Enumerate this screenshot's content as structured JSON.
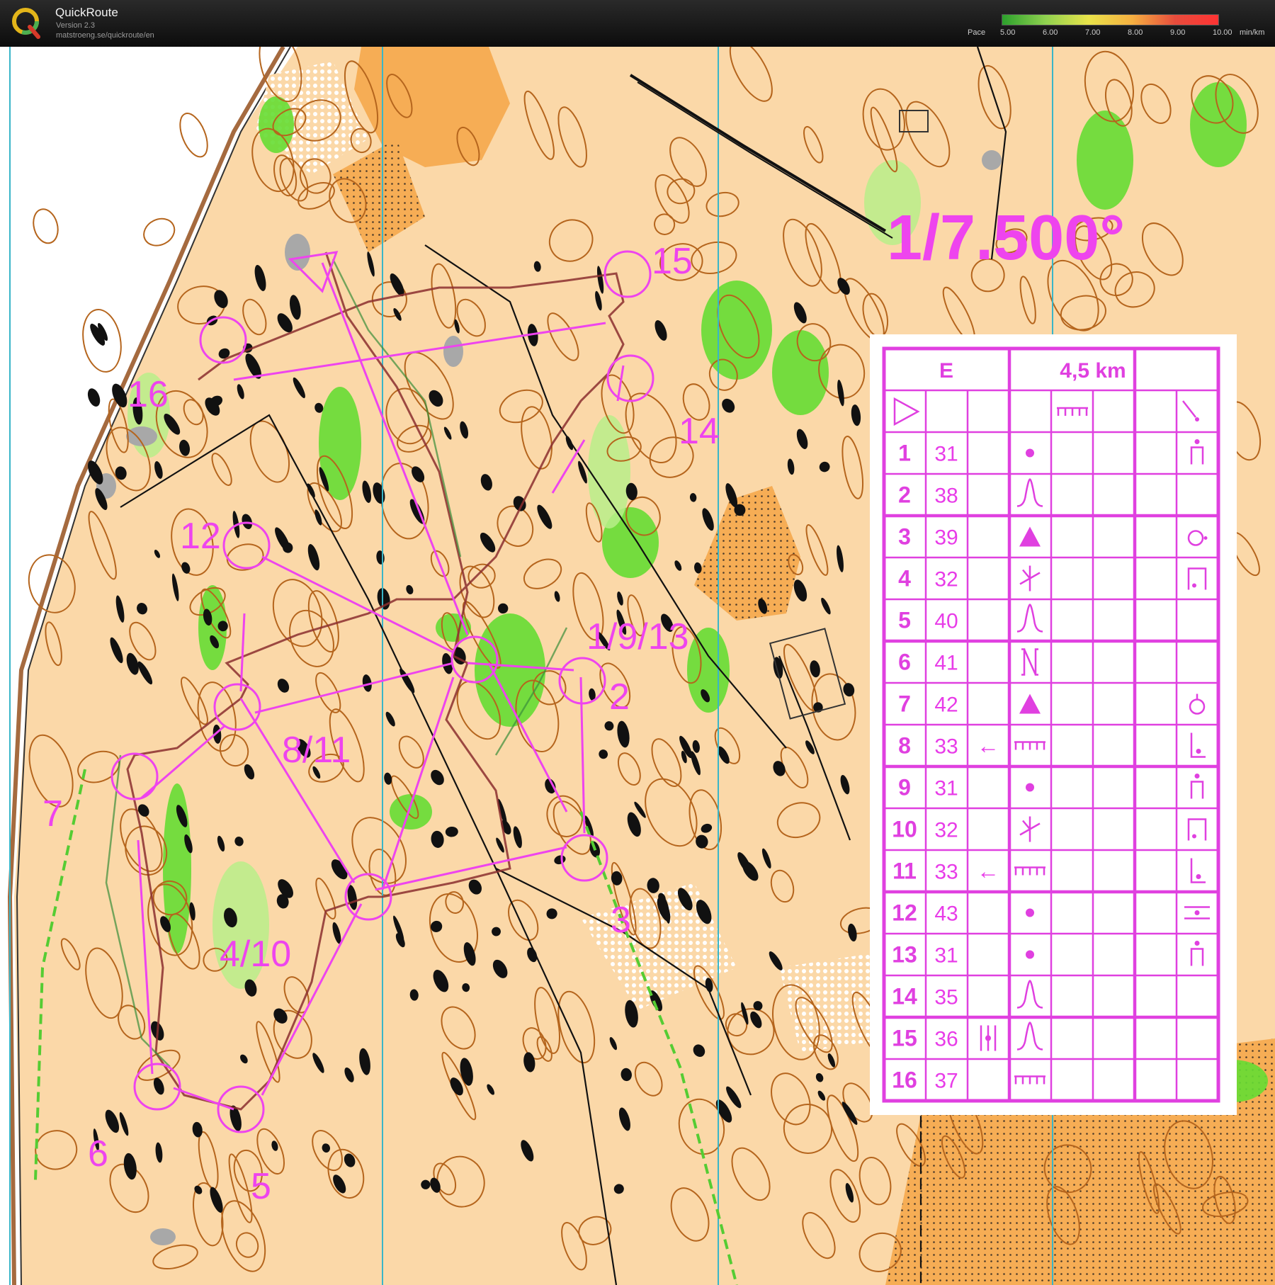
{
  "app": {
    "name": "QuickRoute",
    "version": "Version 2.3",
    "url": "matstroeng.se/quickroute/en"
  },
  "pace_legend": {
    "label": "Pace",
    "ticks": [
      "5.00",
      "6.00",
      "7.00",
      "8.00",
      "9.00",
      "10.00"
    ],
    "unit": "min/km",
    "colors": [
      "#2ca02c",
      "#8fd14f",
      "#e9e34a",
      "#f5b041",
      "#e74c3c"
    ]
  },
  "map": {
    "scale_label": "1/7.500°",
    "colors": {
      "open_land": "#fbd8a8",
      "rough_open": "#f7b25a",
      "vegetation": "#66dd33",
      "contour": "#b5651d",
      "course": "#ee44ee",
      "route": "#8b2f2f",
      "water_grid": "#39b5c8"
    },
    "controls": [
      {
        "label": "1/9/13"
      },
      {
        "label": "2"
      },
      {
        "label": "3"
      },
      {
        "label": "4/10"
      },
      {
        "label": "5"
      },
      {
        "label": "6"
      },
      {
        "label": "7"
      },
      {
        "label": "8/11"
      },
      {
        "label": "12"
      },
      {
        "label": "14"
      },
      {
        "label": "15"
      },
      {
        "label": "16"
      }
    ]
  },
  "control_card": {
    "class": "E",
    "length": "4,5 km",
    "rows": [
      {
        "num": "1",
        "code": "31",
        "dir": "",
        "feature": "dot",
        "detail": "dot-pole"
      },
      {
        "num": "2",
        "code": "38",
        "dir": "",
        "feature": "knoll",
        "detail": ""
      },
      {
        "num": "3",
        "code": "39",
        "dir": "",
        "feature": "triangle",
        "detail": "circle-dot"
      },
      {
        "num": "4",
        "code": "32",
        "dir": "",
        "feature": "cliff-fork",
        "detail": "box-dot"
      },
      {
        "num": "5",
        "code": "40",
        "dir": "",
        "feature": "knoll",
        "detail": ""
      },
      {
        "num": "6",
        "code": "41",
        "dir": "",
        "feature": "bracket",
        "detail": ""
      },
      {
        "num": "7",
        "code": "42",
        "dir": "",
        "feature": "triangle",
        "detail": "circle-top"
      },
      {
        "num": "8",
        "code": "33",
        "dir": "←",
        "feature": "comb",
        "detail": "corner-dot"
      },
      {
        "num": "9",
        "code": "31",
        "dir": "",
        "feature": "dot",
        "detail": "dot-pole"
      },
      {
        "num": "10",
        "code": "32",
        "dir": "",
        "feature": "cliff-fork",
        "detail": "box-dot"
      },
      {
        "num": "11",
        "code": "33",
        "dir": "←",
        "feature": "comb",
        "detail": "corner-dot"
      },
      {
        "num": "12",
        "code": "43",
        "dir": "",
        "feature": "dot",
        "detail": "between"
      },
      {
        "num": "13",
        "code": "31",
        "dir": "",
        "feature": "dot",
        "detail": "dot-pole"
      },
      {
        "num": "14",
        "code": "35",
        "dir": "",
        "feature": "knoll",
        "detail": ""
      },
      {
        "num": "15",
        "code": "36",
        "dir": "bars",
        "feature": "knoll",
        "detail": ""
      },
      {
        "num": "16",
        "code": "37",
        "dir": "",
        "feature": "comb",
        "detail": ""
      }
    ]
  }
}
